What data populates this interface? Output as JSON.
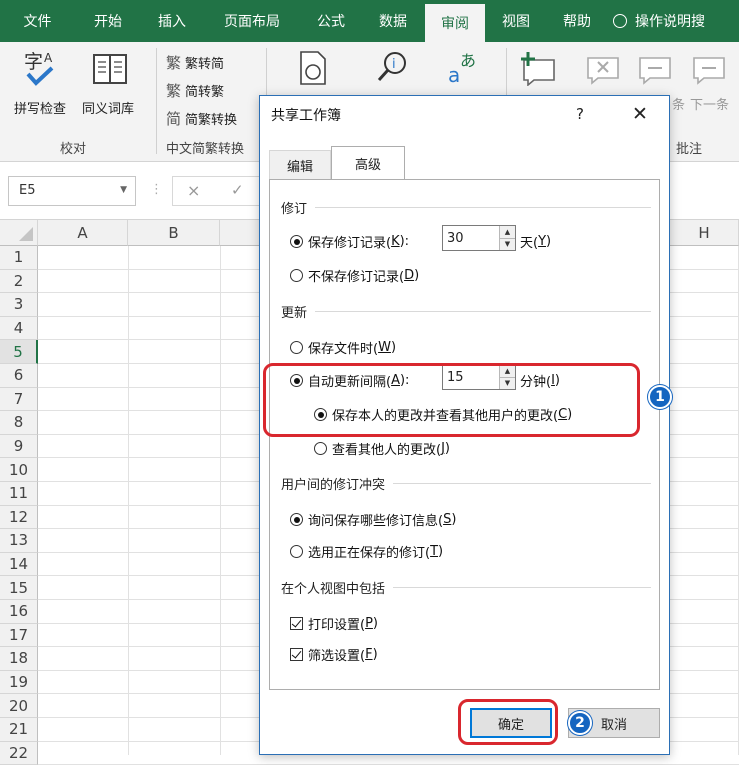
{
  "ribbon_tabs": [
    "文件",
    "开始",
    "插入",
    "页面布局",
    "公式",
    "数据",
    "审阅",
    "视图",
    "帮助",
    "操作说明搜"
  ],
  "active_tab": "审阅",
  "ribbon": {
    "spelling": "拼写检查",
    "thesaurus": "同义词库",
    "group_proofing": "校对",
    "to_traditional": "繁转简",
    "to_simplified": "简转繁",
    "convert": "简繁转换",
    "group_chinese": "中文简繁转换",
    "icon_zi": "字",
    "icon_a": "A",
    "icon_a2": "a",
    "icon_b": "あ",
    "icon_fan": "繁",
    "icon_jian": "繁",
    "icon_fan2": "简",
    "partial_prev": "条",
    "next_comment": "下一条",
    "group_comments": "批注"
  },
  "name_box": "E5",
  "formula_icons": [
    "×",
    "✓"
  ],
  "columns": [
    "A",
    "B",
    "H"
  ],
  "rows": [
    "1",
    "2",
    "3",
    "4",
    "5",
    "6",
    "7",
    "8",
    "9",
    "10",
    "11",
    "12",
    "13",
    "14",
    "15",
    "16",
    "17",
    "18",
    "19",
    "20",
    "21",
    "22"
  ],
  "active_row": "5",
  "dialog": {
    "title": "共享工作簿",
    "help": "?",
    "close": "✕",
    "tabs": [
      "编辑",
      "高级"
    ],
    "active_tab": "高级",
    "section_track": "修订",
    "keep_history": {
      "pre": "保存修订记录(",
      "key": "K",
      "post": "):"
    },
    "days_value": "30",
    "days_unit": {
      "pre": "天(",
      "key": "Y",
      "post": ")"
    },
    "no_history": {
      "pre": "不保存修订记录(",
      "key": "D",
      "post": ")"
    },
    "section_update": "更新",
    "when_saved": {
      "pre": "保存文件时(",
      "key": "W",
      "post": ")"
    },
    "auto_every": {
      "pre": "自动更新间隔(",
      "key": "A",
      "post": "):"
    },
    "minutes_value": "15",
    "minutes_unit": {
      "pre": "分钟(",
      "key": "I",
      "post": ")"
    },
    "save_mine": {
      "pre": "保存本人的更改并查看其他用户的更改(",
      "key": "C",
      "post": ")"
    },
    "just_see": {
      "pre": "查看其他人的更改(",
      "key": "J",
      "post": ")"
    },
    "section_conflict": "用户间的修订冲突",
    "ask_me": {
      "pre": "询问保存哪些修订信息(",
      "key": "S",
      "post": ")"
    },
    "changes_saved_win": {
      "pre": "选用正在保存的修订(",
      "key": "T",
      "post": ")"
    },
    "section_view": "在个人视图中包括",
    "print_settings": {
      "pre": "打印设置(",
      "key": "P",
      "post": ")"
    },
    "filter_settings": {
      "pre": "筛选设置(",
      "key": "F",
      "post": ")"
    },
    "ok": "确定",
    "cancel": "取消"
  },
  "callouts": {
    "badge1": "1",
    "badge2": "2"
  },
  "colors": {
    "excel_green": "#217346",
    "callout_red": "#d9272e",
    "badge_blue": "#1565c0"
  }
}
